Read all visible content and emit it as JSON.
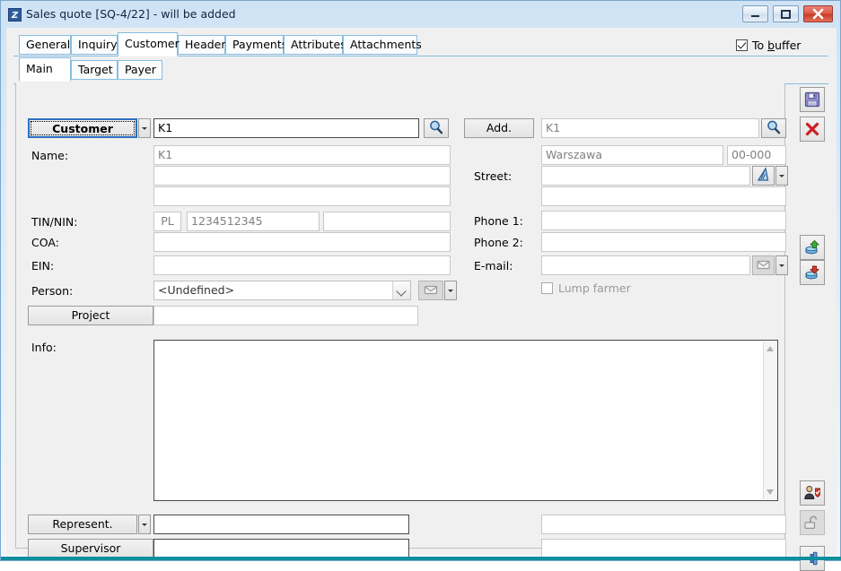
{
  "window": {
    "title": "Sales quote [SQ-4/22] - will be added",
    "app_icon": "Z",
    "controls": {
      "minimize": "minimize-icon",
      "maximize": "maximize-icon",
      "close": "close-icon"
    }
  },
  "header": {
    "to_buffer": {
      "label_before": "To ",
      "accel": "b",
      "label_after": "uffer",
      "checked": true
    }
  },
  "tabs": {
    "main": [
      {
        "label": "General",
        "active": false
      },
      {
        "label": "Inquiry",
        "active": false
      },
      {
        "label": "Customer",
        "active": true
      },
      {
        "label": "Header",
        "active": false
      },
      {
        "label": "Payments",
        "active": false
      },
      {
        "label": "Attributes",
        "active": false
      },
      {
        "label": "Attachments",
        "active": false
      }
    ],
    "sub": [
      {
        "label": "Main",
        "active": true
      },
      {
        "label": "Target",
        "active": false
      },
      {
        "label": "Payer",
        "active": false
      }
    ]
  },
  "form": {
    "customer_button": "Customer",
    "customer_value": "K1",
    "name_label": "Name:",
    "name_1": "K1",
    "name_2": "",
    "name_3": "",
    "tin_label": "TIN/NIN:",
    "tin_prefix": "PL",
    "tin_number": "1234512345",
    "tin_extra": "",
    "coa_label": "COA:",
    "coa_value": "",
    "ein_label": "EIN:",
    "ein_value": "",
    "person_label": "Person:",
    "person_value": "<Undefined>",
    "project_button": "Project",
    "project_value": "",
    "info_label": "Info:",
    "info_value": "",
    "add_button": "Add.",
    "add_value": "K1",
    "city_value": "Warszawa",
    "postcode_value": "00-000",
    "street_label": "Street:",
    "street_value": "",
    "street_2": "",
    "phone1_label": "Phone 1:",
    "phone1_value": "",
    "phone2_label": "Phone 2:",
    "phone2_value": "",
    "email_label": "E-mail:",
    "email_value": "",
    "lump_farmer_label": "Lump farmer",
    "lump_farmer_checked": false,
    "represent_button": "Represent.",
    "represent_value": "",
    "represent_value_right": "",
    "supervisor_button": "Supervisor",
    "supervisor_value": "",
    "supervisor_value_right": ""
  },
  "icons": {
    "customer_search": "search-icon",
    "address_search": "search-icon",
    "street_map": "map-icon",
    "person_mail": "envelope-icon",
    "email_mail": "envelope-icon"
  },
  "toolbar": {
    "items": [
      {
        "name": "save-button",
        "icon": "floppy-disk-icon",
        "disabled": false
      },
      {
        "name": "delete-button",
        "icon": "red-x-icon",
        "disabled": false
      },
      {
        "name": "import-button",
        "icon": "database-up-icon",
        "disabled": false
      },
      {
        "name": "export-button",
        "icon": "database-down-icon",
        "disabled": false
      },
      {
        "name": "permissions-button",
        "icon": "user-shield-icon",
        "disabled": false
      },
      {
        "name": "lock-button",
        "icon": "unlocked-padlock-icon",
        "disabled": true
      },
      {
        "name": "pin-button",
        "icon": "pin-icon",
        "disabled": false
      }
    ]
  },
  "colors": {
    "accent": "#2b6fc0",
    "tab_border": "#87bde0",
    "bottom_bar": "#0f8f9e",
    "close_button": "#c63a28"
  }
}
